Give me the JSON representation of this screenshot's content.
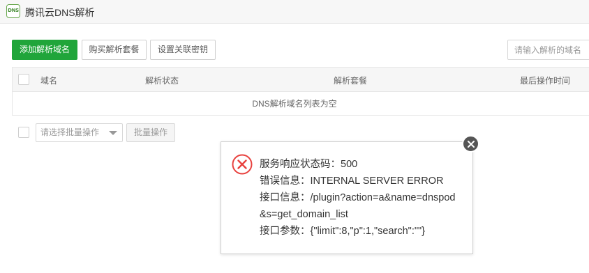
{
  "app": {
    "title": "腾讯云DNS解析",
    "logo_text": "DNS"
  },
  "toolbar": {
    "add_label": "添加解析域名",
    "buy_label": "购买解析套餐",
    "key_label": "设置关联密钥",
    "search_placeholder": "请输入解析的域名"
  },
  "table": {
    "columns": [
      "域名",
      "解析状态",
      "解析套餐",
      "最后操作时间"
    ],
    "empty_text": "DNS解析域名列表为空"
  },
  "batch": {
    "select_placeholder": "请选择批量操作",
    "button_label": "批量操作"
  },
  "dialog": {
    "line1": "服务响应状态码：500",
    "line2": "错误信息：INTERNAL SERVER ERROR",
    "line3": "接口信息：/plugin?action=a&name=dnspod&s=get_domain_list",
    "line4": "接口参数：{\"limit\":8,\"p\":1,\"search\":\"\"}"
  },
  "colors": {
    "primary": "#20a53a",
    "error": "#e8413e",
    "close": "#555555"
  }
}
